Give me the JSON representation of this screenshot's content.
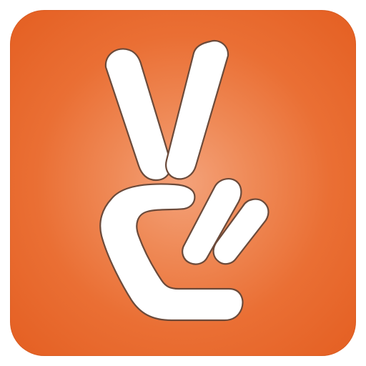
{
  "app_icon": {
    "icon_name": "peace-hand-icon",
    "colors": {
      "tile_center": "#f4a27a",
      "tile_edge": "#e45f22",
      "glyph_fill": "#ffffff",
      "glyph_outline": "#6b4a3a"
    }
  }
}
